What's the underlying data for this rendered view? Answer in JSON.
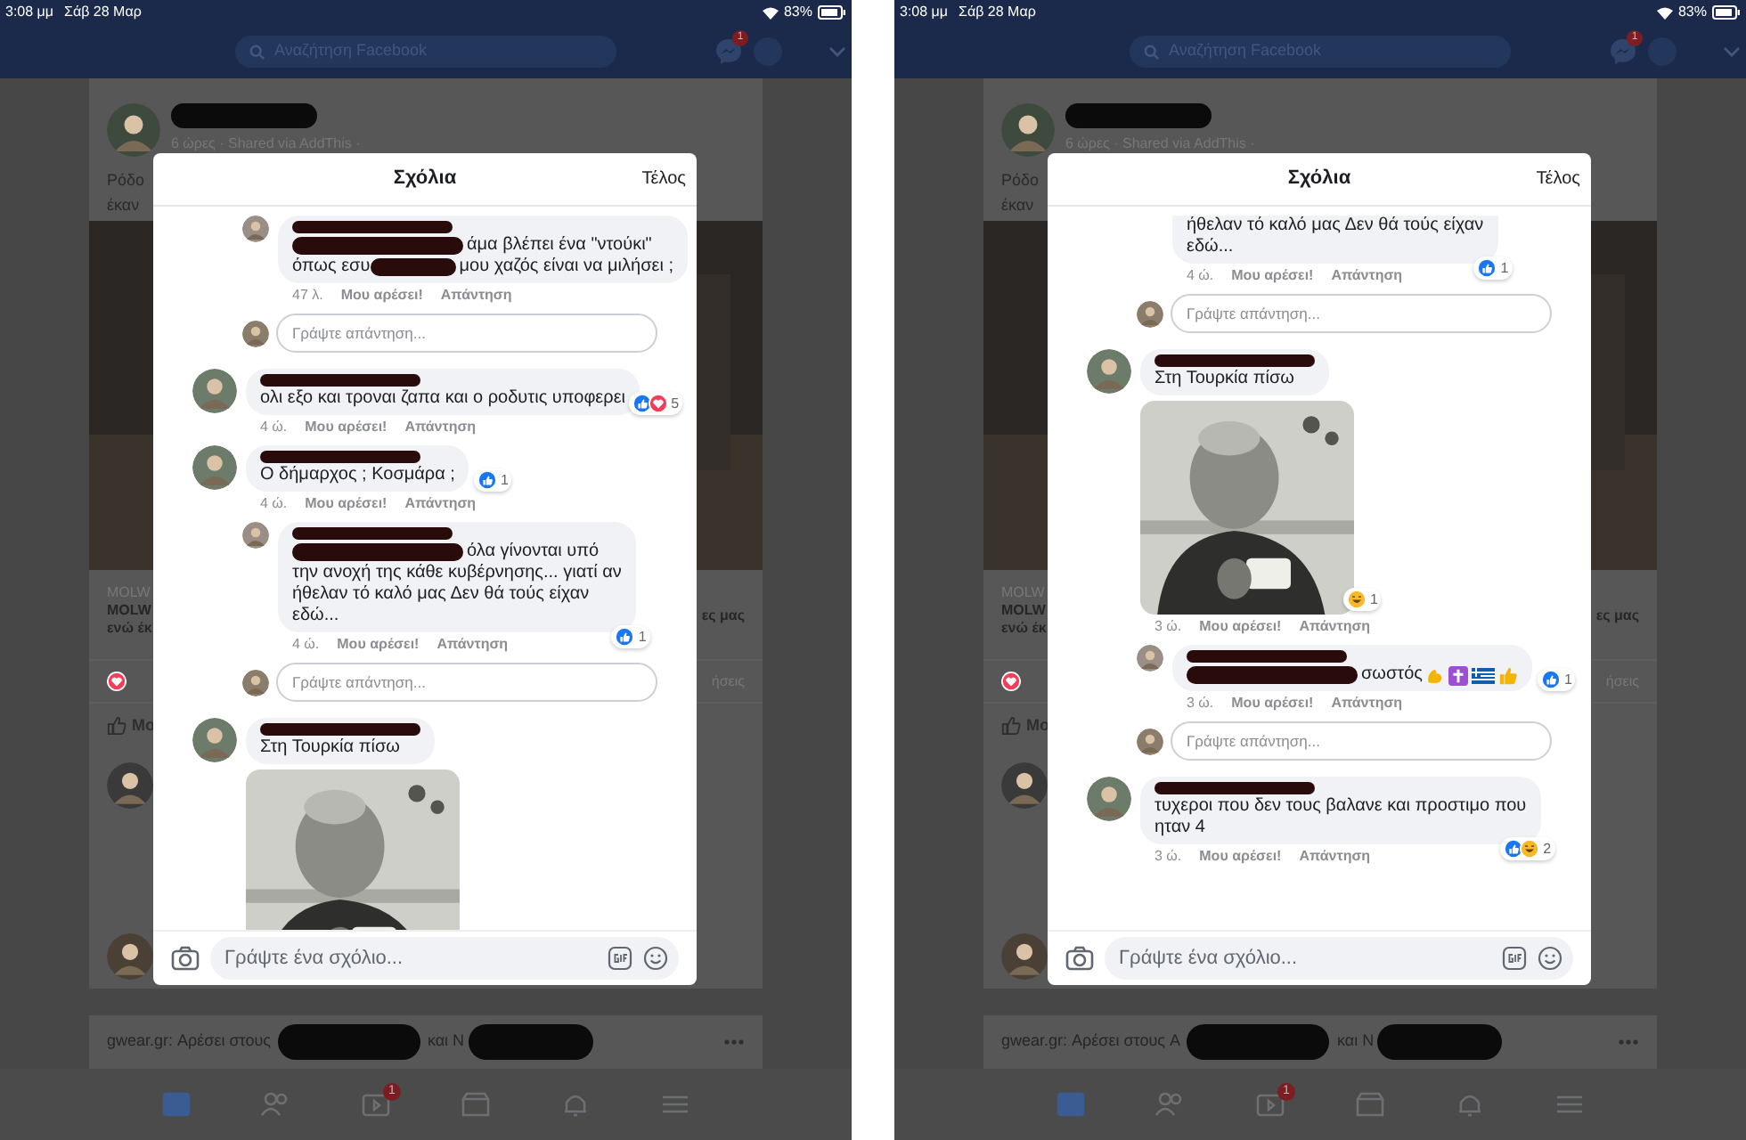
{
  "screens": [
    {
      "status": {
        "time": "3:08 μμ",
        "date": "Σάβ 28 Μαρ",
        "battery": "83%"
      },
      "search": {
        "placeholder": "Αναζήτηση Facebook"
      },
      "messenger_badge": "1",
      "post": {
        "meta": "6 ώρες · Shared via AddThis ·",
        "text_lines": [
          "Ρόδο",
          "έκαν"
        ],
        "link_source": "MOLW",
        "link_title": "MOLW",
        "link_title_2": "ενώ έκ",
        "link_right": "ες μας",
        "reactions_right": "ήσεις",
        "like_button": "Μο"
      },
      "next_post": {
        "text": "gwear.gr: Αρέσει στους",
        "text_2": "και N"
      },
      "tab_badge": "1",
      "modal": {
        "title": "Σχόλια",
        "done": "Τέλος",
        "composer": {
          "placeholder": "Γράψτε ένα σχόλιο..."
        },
        "items": [
          {
            "kind": "reply",
            "cut_top": false,
            "lines": [
              [
                {
                  "kind": "redacted"
                },
                {
                  "kind": "text",
                  "text": "άμα βλέπει ένα \"ντούκι\""
                }
              ],
              [
                {
                  "kind": "text",
                  "text": "όπως εσυ"
                },
                {
                  "kind": "redacted"
                },
                {
                  "kind": "text",
                  "text": "μου χαζός είναι να μιλήσει ;"
                }
              ]
            ],
            "time": "47 λ.",
            "like": "Μου αρέσει!",
            "reply": "Απάντηση"
          },
          {
            "kind": "reply_field",
            "placeholder": "Γράψτε απάντηση..."
          },
          {
            "kind": "comment",
            "cut_top": false,
            "lines": [
              [
                {
                  "kind": "text",
                  "text": "ολι εξο και τροναι ζαπα και ο ροδυτις υποφερει"
                }
              ]
            ],
            "time": "4 ώ.",
            "like": "Μου αρέσει!",
            "reply": "Απάντηση",
            "reactions": [
              {
                "kind": "like"
              },
              {
                "kind": "love"
              }
            ],
            "reaction_count": "5"
          },
          {
            "kind": "comment",
            "cut_top": false,
            "lines": [
              [
                {
                  "kind": "text",
                  "text": "Ο δήμαρχος ; Κοσμάρα ;"
                }
              ]
            ],
            "time": "4 ώ.",
            "like": "Μου αρέσει!",
            "reply": "Απάντηση",
            "reactions": [
              {
                "kind": "like"
              }
            ],
            "reaction_count": "1"
          },
          {
            "kind": "reply",
            "cut_top": false,
            "lines": [
              [
                {
                  "kind": "redacted"
                },
                {
                  "kind": "text",
                  "text": "όλα γίνονται υπό"
                }
              ],
              [
                {
                  "kind": "text",
                  "text": "την ανοχή της κάθε κυβέρνησης... γιατί αν"
                }
              ],
              [
                {
                  "kind": "text",
                  "text": "ήθελαν τό καλό μας Δεν θά τούς είχαν"
                }
              ],
              [
                {
                  "kind": "text",
                  "text": "εδώ..."
                }
              ]
            ],
            "time": "4 ώ.",
            "like": "Μου αρέσει!",
            "reply": "Απάντηση",
            "reactions": [
              {
                "kind": "like"
              }
            ],
            "reaction_count": "1"
          },
          {
            "kind": "reply_field",
            "placeholder": "Γράψτε απάντηση..."
          },
          {
            "kind": "comment",
            "cut_top": false,
            "lines": [
              [
                {
                  "kind": "text",
                  "text": "Στη Τουρκία πίσω"
                }
              ]
            ],
            "attachment": {
              "kind": "picture"
            }
          }
        ]
      }
    },
    {
      "status": {
        "time": "3:08 μμ",
        "date": "Σάβ 28 Μαρ",
        "battery": "83%"
      },
      "search": {
        "placeholder": "Αναζήτηση Facebook"
      },
      "messenger_badge": "1",
      "post": {
        "meta": "6 ώρες · Shared via AddThis ·",
        "text_lines": [
          "Ρόδο",
          "έκαν"
        ],
        "link_source": "MOLW",
        "link_title": "MOLW",
        "link_title_2": "ενώ έκ",
        "link_right": "ες μας",
        "reactions_right": "ήσεις",
        "like_button": "Μο"
      },
      "next_post": {
        "text": "gwear.gr: Αρέσει στους A",
        "text_2": "και N"
      },
      "tab_badge": "1",
      "modal": {
        "title": "Σχόλια",
        "done": "Τέλος",
        "composer": {
          "placeholder": "Γράψτε ένα σχόλιο..."
        },
        "items": [
          {
            "kind": "reply",
            "cut_top": true,
            "lines": [
              [
                {
                  "kind": "text",
                  "text": "ήθελαν τό καλό μας Δεν θά τούς είχαν"
                }
              ],
              [
                {
                  "kind": "text",
                  "text": "εδώ..."
                }
              ]
            ],
            "time": "4 ώ.",
            "like": "Μου αρέσει!",
            "reply": "Απάντηση",
            "reactions": [
              {
                "kind": "like"
              }
            ],
            "reaction_count": "1"
          },
          {
            "kind": "reply_field",
            "placeholder": "Γράψτε απάντηση..."
          },
          {
            "kind": "comment",
            "cut_top": false,
            "lines": [
              [
                {
                  "kind": "text",
                  "text": "Στη Τουρκία πίσω"
                }
              ]
            ],
            "attachment": {
              "kind": "picture"
            },
            "time": "3 ώ.",
            "like": "Μου αρέσει!",
            "reply": "Απάντηση",
            "reactions": [
              {
                "kind": "haha"
              }
            ],
            "reaction_count": "1"
          },
          {
            "kind": "reply",
            "cut_top": false,
            "lines": [
              [
                {
                  "kind": "redacted"
                },
                {
                  "kind": "text",
                  "text": "σωστός"
                },
                {
                  "kind": "biceps"
                },
                {
                  "kind": "cross"
                },
                {
                  "kind": "flag"
                },
                {
                  "kind": "thumbs_up"
                }
              ]
            ],
            "time": "3 ώ.",
            "like": "Μου αρέσει!",
            "reply": "Απάντηση",
            "reactions": [
              {
                "kind": "like"
              }
            ],
            "reaction_count": "1"
          },
          {
            "kind": "reply_field",
            "placeholder": "Γράψτε απάντηση..."
          },
          {
            "kind": "comment",
            "cut_top": false,
            "lines": [
              [
                {
                  "kind": "text",
                  "text": "τυχεροι που δεν τους βαλανε και προστιμο που"
                }
              ],
              [
                {
                  "kind": "text",
                  "text": "ηταν 4"
                }
              ]
            ],
            "time": "3 ώ.",
            "like": "Μου αρέσει!",
            "reply": "Απάντηση",
            "reactions": [
              {
                "kind": "like"
              },
              {
                "kind": "haha"
              }
            ],
            "reaction_count": "2"
          }
        ]
      }
    }
  ]
}
